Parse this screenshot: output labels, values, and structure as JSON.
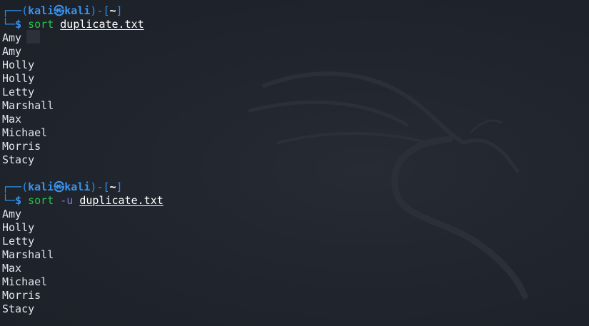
{
  "prompt": {
    "frame_top": "┌──",
    "frame_bottom": "└─",
    "open_paren": "(",
    "user": "kali",
    "skull": "㉿",
    "host": "kali",
    "close_paren_sep": ")-[",
    "dir": "~",
    "close_bracket": "]",
    "dollar": "$"
  },
  "session1": {
    "command": "sort",
    "file_arg": "duplicate.txt",
    "output": [
      "Amy",
      "Amy",
      "Holly",
      "Holly",
      "Letty",
      "Marshall",
      "Max",
      "Michael",
      "Morris",
      "Stacy"
    ]
  },
  "session2": {
    "command": "sort",
    "flag": "-u",
    "file_arg": "duplicate.txt",
    "output": [
      "Amy",
      "Holly",
      "Letty",
      "Marshall",
      "Max",
      "Michael",
      "Morris",
      "Stacy"
    ]
  },
  "colors": {
    "background": "#1f232b",
    "prompt_blue": "#3b94ee",
    "command_green": "#27c24c",
    "flag_purple": "#8a6fd6",
    "text": "#e2e5ea"
  },
  "icons": {
    "watermark": "kali-dragon-icon"
  }
}
